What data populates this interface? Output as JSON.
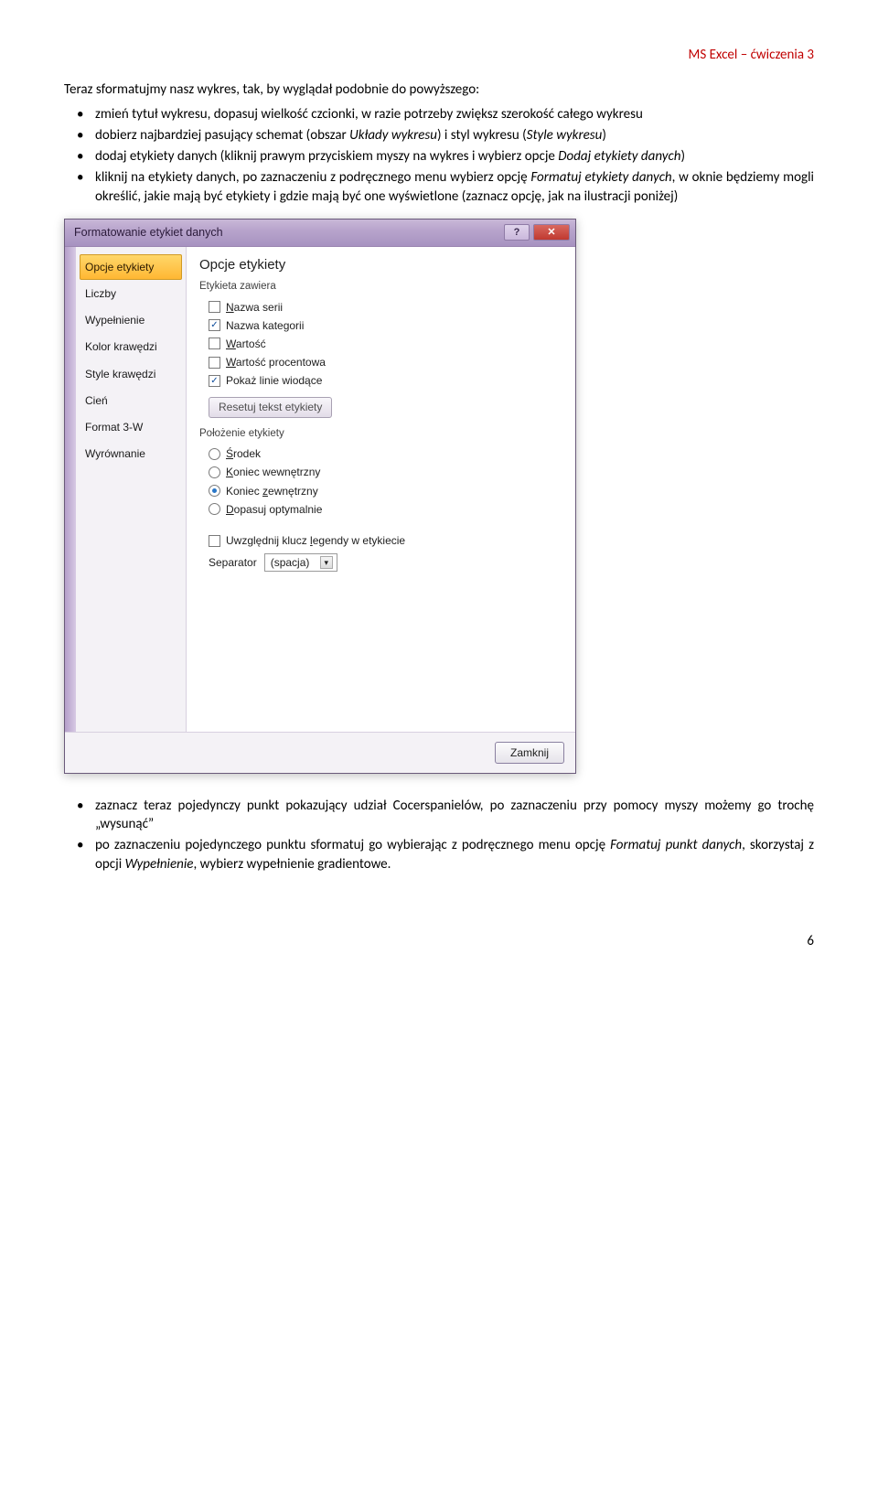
{
  "header": {
    "right": "MS Excel – ćwiczenia 3"
  },
  "intro": "Teraz sformatujmy nasz wykres, tak, by wyglądał podobnie do powyższego:",
  "bullets_top": [
    {
      "text": "zmień tytuł wykresu, dopasuj wielkość czcionki, w razie potrzeby zwiększ szerokość całego wykresu"
    },
    {
      "pre": "dobierz najbardziej pasujący schemat (obszar ",
      "it1": "Układy wykresu",
      "mid1": ") i styl wykresu (",
      "it2": "Style wykresu",
      "post": ")"
    },
    {
      "pre": "dodaj etykiety danych (kliknij prawym przyciskiem myszy na wykres i wybierz opcje ",
      "it1": "Dodaj etykiety danych",
      "post": ")"
    },
    {
      "pre": "kliknij na etykiety danych, po zaznaczeniu z podręcznego menu wybierz opcję ",
      "it1": "Formatuj etykiety danych",
      "post": ", w oknie będziemy mogli określić, jakie mają być etykiety i gdzie mają być one wyświetlone (zaznacz opcję, jak na ilustracji poniżej)"
    }
  ],
  "dialog": {
    "title": "Formatowanie etykiet danych",
    "help": "?",
    "close_x": "✕",
    "sidebar": [
      "Opcje etykiety",
      "Liczby",
      "Wypełnienie",
      "Kolor krawędzi",
      "Style krawędzi",
      "Cień",
      "Format 3-W",
      "Wyrównanie"
    ],
    "pane_title": "Opcje etykiety",
    "group1_label": "Etykieta zawiera",
    "checks": [
      {
        "checked": false,
        "u": "N",
        "rest": "azwa serii"
      },
      {
        "checked": true,
        "u": "",
        "rest": "Nazwa kategorii"
      },
      {
        "checked": false,
        "u": "W",
        "rest": "artość"
      },
      {
        "checked": false,
        "u": "W",
        "rest": "artość procentowa"
      },
      {
        "checked": true,
        "u": "",
        "rest": "Pokaż linie wiodące"
      }
    ],
    "reset_label": "Resetuj tekst etykiety",
    "group2_label": "Położenie etykiety",
    "radios": [
      {
        "sel": false,
        "u": "Ś",
        "pre": "",
        "rest": "rodek"
      },
      {
        "sel": false,
        "u": "K",
        "pre": "",
        "rest": "oniec wewnętrzny"
      },
      {
        "sel": true,
        "u": "z",
        "pre": "Koniec ",
        "rest": "ewnętrzny"
      },
      {
        "sel": false,
        "u": "D",
        "pre": "",
        "rest": "opasuj optymalnie"
      }
    ],
    "legend_key": {
      "checked": false,
      "pre": "Uwzględnij klucz ",
      "u": "l",
      "rest": "egendy w etykiecie"
    },
    "separator_label": "Separator",
    "separator_value": "(spacja)",
    "close_btn": "Zamknij"
  },
  "bullets_bottom": [
    {
      "text": "zaznacz teraz pojedynczy punkt pokazujący udział Cocerspanielów, po zaznaczeniu przy pomocy myszy możemy go trochę „wysunąć”"
    },
    {
      "pre": "po zaznaczeniu pojedynczego punktu sformatuj go wybierając z podręcznego menu opcję ",
      "it1": "Formatuj punkt danych",
      "mid1": ", skorzystaj z opcji ",
      "it2": "Wypełnienie",
      "post": ", wybierz wypełnienie gradientowe."
    }
  ],
  "page_number": "6"
}
